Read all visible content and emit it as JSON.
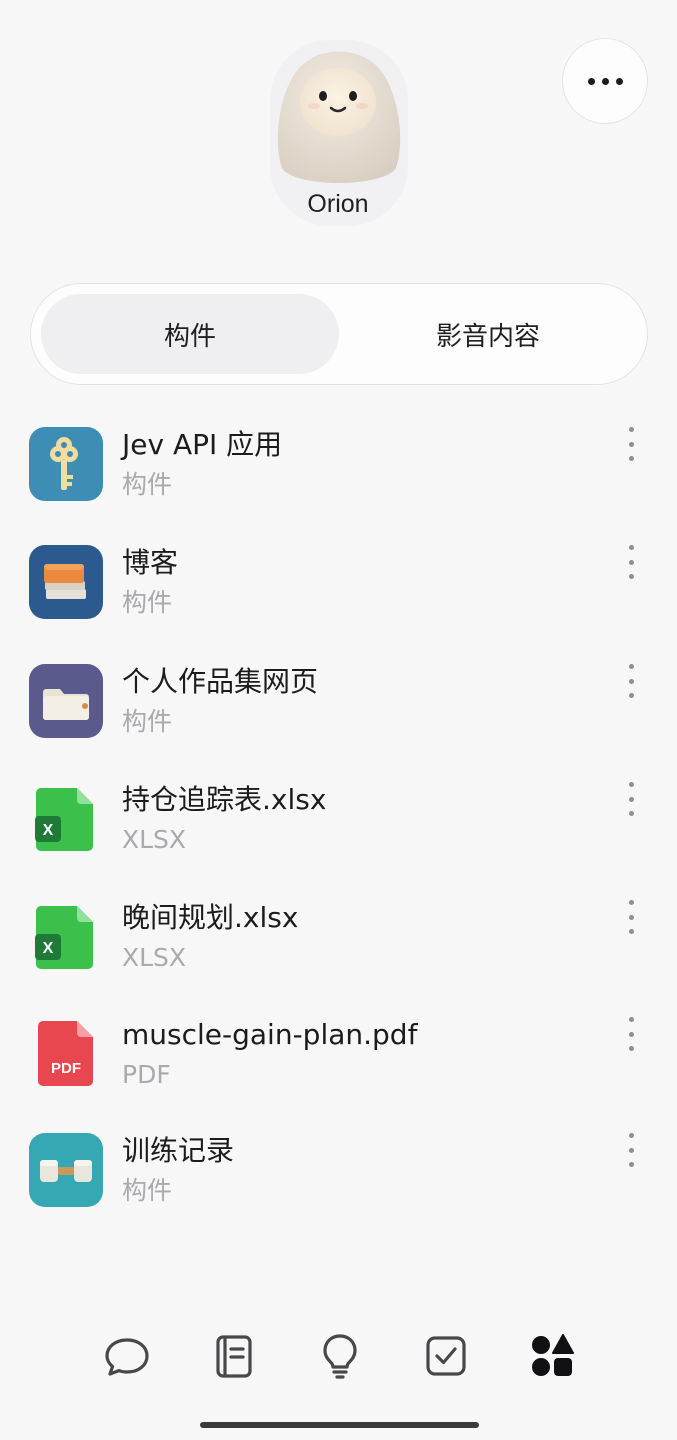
{
  "header": {
    "profile_name": "Orion",
    "more_icon": "more-horizontal-icon"
  },
  "tabs": [
    {
      "label": "构件",
      "active": true
    },
    {
      "label": "影音内容",
      "active": false
    }
  ],
  "items": [
    {
      "title": "Jev API 应用",
      "subtitle": "构件",
      "icon": "key-app-icon"
    },
    {
      "title": "博客",
      "subtitle": "构件",
      "icon": "books-app-icon"
    },
    {
      "title": "个人作品集网页",
      "subtitle": "构件",
      "icon": "folder-app-icon"
    },
    {
      "title": "持仓追踪表.xlsx",
      "subtitle": "XLSX",
      "icon": "excel-file-icon"
    },
    {
      "title": "晚间规划.xlsx",
      "subtitle": "XLSX",
      "icon": "excel-file-icon"
    },
    {
      "title": "muscle-gain-plan.pdf",
      "subtitle": "PDF",
      "icon": "pdf-file-icon",
      "badge": "PDF"
    },
    {
      "title": "训练记录",
      "subtitle": "构件",
      "icon": "dumbbell-app-icon"
    }
  ],
  "bottom_nav": [
    {
      "icon": "chat-bubble-icon",
      "active": false
    },
    {
      "icon": "notebook-icon",
      "active": false
    },
    {
      "icon": "lightbulb-icon",
      "active": false
    },
    {
      "icon": "checkbox-icon",
      "active": false
    },
    {
      "icon": "shapes-icon",
      "active": true
    }
  ],
  "colors": {
    "background": "#f7f7f8",
    "active_tab": "#efeff2",
    "secondary_text": "#a9a9ae",
    "excel_green": "#3cc04c",
    "pdf_red": "#e8474f",
    "key_app_bg": "#3d8db5",
    "books_app_bg": "#2d5a8e",
    "folder_app_bg": "#5b5a8c",
    "dumbbell_app_bg": "#35a8b4"
  }
}
